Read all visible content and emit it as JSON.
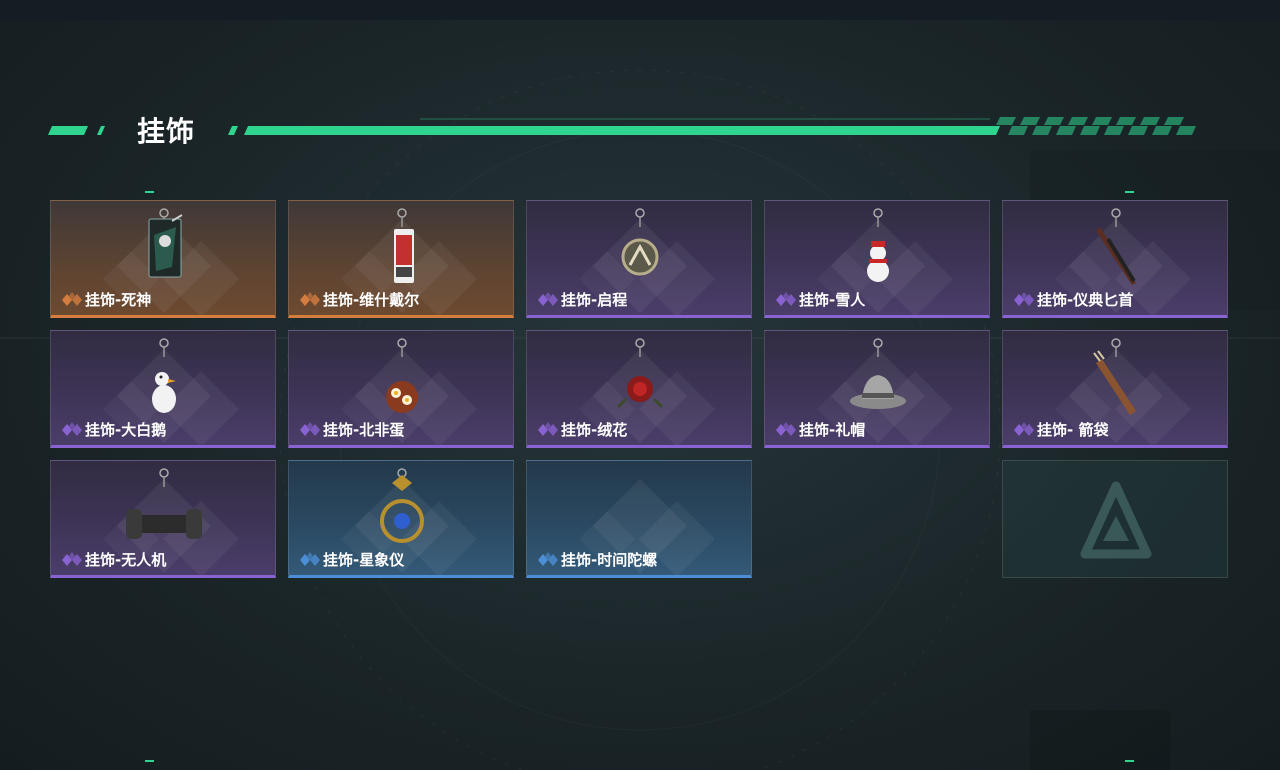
{
  "header": {
    "title": "挂饰"
  },
  "colors": {
    "accent": "#2fd58f",
    "orange": "#d57d3f",
    "purple": "#8a63d2",
    "blue": "#4d8fd6"
  },
  "cards": [
    {
      "label": "挂饰-死神",
      "rarity": "orange",
      "icon": "reaper-charm-icon"
    },
    {
      "label": "挂饰-维什戴尔",
      "rarity": "orange",
      "icon": "card-charm-icon"
    },
    {
      "label": "挂饰-启程",
      "rarity": "purple",
      "icon": "medal-charm-icon"
    },
    {
      "label": "挂饰-雪人",
      "rarity": "purple",
      "icon": "snowman-charm-icon"
    },
    {
      "label": "挂饰-仪典匕首",
      "rarity": "purple",
      "icon": "dagger-charm-icon"
    },
    {
      "label": "挂饰-大白鹅",
      "rarity": "purple",
      "icon": "goose-charm-icon"
    },
    {
      "label": "挂饰-北非蛋",
      "rarity": "purple",
      "icon": "shakshuka-charm-icon"
    },
    {
      "label": "挂饰-绒花",
      "rarity": "purple",
      "icon": "rose-charm-icon"
    },
    {
      "label": "挂饰-礼帽",
      "rarity": "purple",
      "icon": "hat-charm-icon"
    },
    {
      "label": "挂饰- 箭袋",
      "rarity": "purple",
      "icon": "quiver-charm-icon"
    },
    {
      "label": "挂饰-无人机",
      "rarity": "purple",
      "icon": "drone-charm-icon"
    },
    {
      "label": "挂饰-星象仪",
      "rarity": "blue",
      "icon": "astrolabe-charm-icon"
    },
    {
      "label": "挂饰-时间陀螺",
      "rarity": "blue",
      "icon": "time-top-charm-icon"
    }
  ],
  "empty_slot": {
    "icon": "placeholder-logo-icon"
  }
}
